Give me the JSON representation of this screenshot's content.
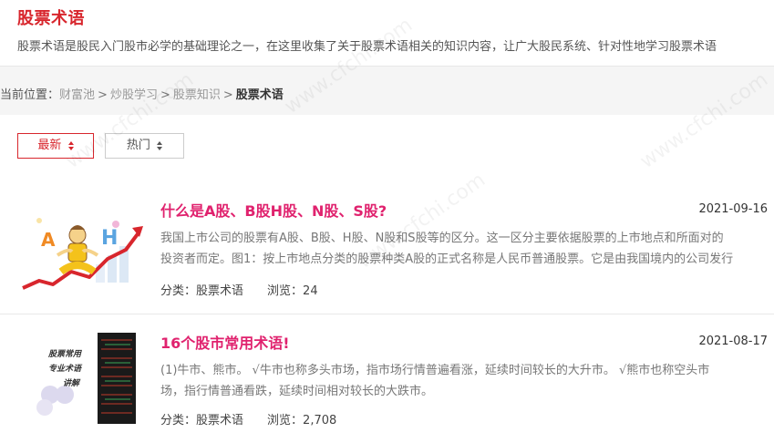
{
  "header": {
    "title": "股票术语",
    "description": "股票术语是股民入门股市必学的基础理论之一，在这里收集了关于股票术语相关的知识内容，让广大股民系统、针对性地学习股票术语"
  },
  "breadcrumb": {
    "label": "当前位置：",
    "items": [
      "财富池",
      "炒股学习",
      "股票知识"
    ],
    "separator": ">",
    "current": "股票术语"
  },
  "sort": {
    "latest": "最新",
    "hot": "热门"
  },
  "watermark_text": "www.cfchi.com",
  "articles": [
    {
      "title": "什么是A股、B股H股、N股、S股?",
      "date": "2021-09-16",
      "summary_lines": [
        "我国上市公司的股票有A股、B股、H股、N股和S股等的区分。这一区分主要依据股票的上市地点和所面对的",
        "投资者而定。图1：按上市地点分类的股票种类A股的正式名称是人民币普通股票。它是由我国境内的公司发行"
      ],
      "category_label": "分类：",
      "category": "股票术语",
      "views_label": "浏览：",
      "views": "24",
      "thumb_icons": [
        "cartoon-figure-icon",
        "letter-a-icon",
        "letter-h-icon",
        "rising-arrow-icon"
      ]
    },
    {
      "title": "16个股市常用术语!",
      "date": "2021-08-17",
      "summary_lines": [
        "(1)牛市、熊市。 √牛市也称多头市场，指市场行情普遍看涨，延续时间较长的大升市。 √熊市也称空头市",
        "场，指行情普通看跌，延续时间相对较长的大跌市。"
      ],
      "category_label": "分类：",
      "category": "股票术语",
      "views_label": "浏览：",
      "views": "2,708",
      "thumb_text": [
        "股票常用",
        "专业术语",
        "讲解"
      ]
    }
  ],
  "colors": {
    "title_red": "#d8262d",
    "article_title_pink": "#e0226e",
    "crumb_bg": "#f5f5f5"
  }
}
